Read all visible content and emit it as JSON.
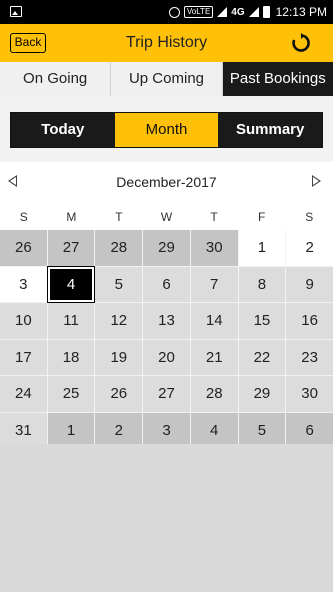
{
  "status_bar": {
    "network_badge": "VoLTE",
    "network_type": "4G",
    "time": "12:13 PM"
  },
  "app_bar": {
    "back_label": "Back",
    "title": "Trip History",
    "refresh_icon": "refresh-icon"
  },
  "tabs": [
    {
      "label": "On Going",
      "active": false
    },
    {
      "label": "Up Coming",
      "active": false
    },
    {
      "label": "Past Bookings",
      "active": true
    }
  ],
  "range": [
    {
      "label": "Today",
      "active": false
    },
    {
      "label": "Month",
      "active": true
    },
    {
      "label": "Summary",
      "active": false
    }
  ],
  "calendar": {
    "month_label": "December-2017",
    "weekdays": [
      "S",
      "M",
      "T",
      "W",
      "T",
      "F",
      "S"
    ],
    "selected_day": "4",
    "days": [
      {
        "d": "26",
        "t": "outside"
      },
      {
        "d": "27",
        "t": "outside"
      },
      {
        "d": "28",
        "t": "outside"
      },
      {
        "d": "29",
        "t": "outside"
      },
      {
        "d": "30",
        "t": "outside"
      },
      {
        "d": "1",
        "t": "weekend-cur"
      },
      {
        "d": "2",
        "t": "weekend-cur"
      },
      {
        "d": "3",
        "t": "weekend-cur"
      },
      {
        "d": "4",
        "t": "selected"
      },
      {
        "d": "5",
        "t": "current"
      },
      {
        "d": "6",
        "t": "current"
      },
      {
        "d": "7",
        "t": "current"
      },
      {
        "d": "8",
        "t": "current"
      },
      {
        "d": "9",
        "t": "current"
      },
      {
        "d": "10",
        "t": "current"
      },
      {
        "d": "11",
        "t": "current"
      },
      {
        "d": "12",
        "t": "current"
      },
      {
        "d": "13",
        "t": "current"
      },
      {
        "d": "14",
        "t": "current"
      },
      {
        "d": "15",
        "t": "current"
      },
      {
        "d": "16",
        "t": "current"
      },
      {
        "d": "17",
        "t": "current"
      },
      {
        "d": "18",
        "t": "current"
      },
      {
        "d": "19",
        "t": "current"
      },
      {
        "d": "20",
        "t": "current"
      },
      {
        "d": "21",
        "t": "current"
      },
      {
        "d": "22",
        "t": "current"
      },
      {
        "d": "23",
        "t": "current"
      },
      {
        "d": "24",
        "t": "current"
      },
      {
        "d": "25",
        "t": "current"
      },
      {
        "d": "26",
        "t": "current"
      },
      {
        "d": "27",
        "t": "current"
      },
      {
        "d": "28",
        "t": "current"
      },
      {
        "d": "29",
        "t": "current"
      },
      {
        "d": "30",
        "t": "current"
      },
      {
        "d": "31",
        "t": "current"
      },
      {
        "d": "1",
        "t": "outside"
      },
      {
        "d": "2",
        "t": "outside"
      },
      {
        "d": "3",
        "t": "outside"
      },
      {
        "d": "4",
        "t": "outside"
      },
      {
        "d": "5",
        "t": "outside"
      },
      {
        "d": "6",
        "t": "outside"
      }
    ]
  },
  "colors": {
    "accent": "#ffc107",
    "dark": "#1a1a1a"
  }
}
